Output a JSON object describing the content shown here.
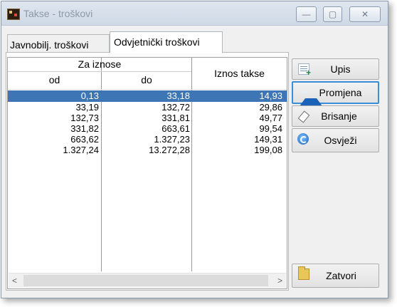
{
  "window": {
    "title": "Takse - troškovi",
    "icon": "app-icon",
    "controls": {
      "minimize": "—",
      "maximize": "▢",
      "close": "✕"
    }
  },
  "tabs": [
    {
      "label": "Javnobilj. troškovi",
      "active": false
    },
    {
      "label": "Odvjetnički troškovi",
      "active": true
    }
  ],
  "grid": {
    "group_header": "Za iznose",
    "columns": [
      "od",
      "do",
      "Iznos takse"
    ],
    "rows": [
      {
        "od": "0,13",
        "do": "33,18",
        "iznos": "14,93",
        "selected": true
      },
      {
        "od": "33,19",
        "do": "132,72",
        "iznos": "29,86",
        "selected": false
      },
      {
        "od": "132,73",
        "do": "331,81",
        "iznos": "49,77",
        "selected": false
      },
      {
        "od": "331,82",
        "do": "663,61",
        "iznos": "99,54",
        "selected": false
      },
      {
        "od": "663,62",
        "do": "1.327,23",
        "iznos": "149,31",
        "selected": false
      },
      {
        "od": "1.327,24",
        "do": "13.272,28",
        "iznos": "199,08",
        "selected": false
      }
    ],
    "scroll": {
      "left": "<",
      "right": ">"
    }
  },
  "buttons": {
    "upis": "Upis",
    "promjena": "Promjena",
    "brisanje": "Brisanje",
    "osvjezi": "Osvježi",
    "zatvori": "Zatvori"
  },
  "colors": {
    "selection": "#3d75b5",
    "focus_border": "#3a8ed8"
  }
}
